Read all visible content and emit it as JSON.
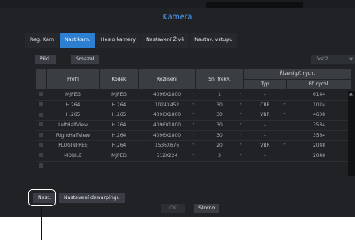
{
  "title": "Kamera",
  "tabs": [
    {
      "label": "Reg. Kam",
      "active": false
    },
    {
      "label": "Nast.kam.",
      "active": true
    },
    {
      "label": "Heslo kamery",
      "active": false
    },
    {
      "label": "Nastavení Živě",
      "active": false
    },
    {
      "label": "Nastav. vstupu",
      "active": false
    }
  ],
  "toolbar": {
    "add_label": "Přid.",
    "delete_label": "Smazat",
    "stream_select": "Vst2"
  },
  "table": {
    "headers": {
      "profile": "Profil",
      "codec": "Kodek",
      "resolution": "Rozlišení",
      "fps": "Sn. frekv.",
      "bitrate_group": "Řízení př. rych.",
      "type": "Typ",
      "bitrate": "Př. rychl."
    },
    "rows": [
      {
        "profile": "MJPEG",
        "codec": "MJPEG",
        "resolution": "4096X1800",
        "fps": "1",
        "type": "–",
        "bitrate": "6144"
      },
      {
        "profile": "H.264",
        "codec": "H.264",
        "resolution": "1024X452",
        "fps": "30",
        "type": "CBR",
        "bitrate": "1024"
      },
      {
        "profile": "H.265",
        "codec": "H.265",
        "resolution": "4096X1800",
        "fps": "30",
        "type": "VBR",
        "bitrate": "4608"
      },
      {
        "profile": "LeftHalfView",
        "codec": "H.264",
        "resolution": "4096X1800",
        "fps": "30",
        "type": "–",
        "bitrate": "3584"
      },
      {
        "profile": "RightHalfView",
        "codec": "H.264",
        "resolution": "4096X1800",
        "fps": "30",
        "type": "–",
        "bitrate": "3584"
      },
      {
        "profile": "PLUGINFREE",
        "codec": "H.264",
        "resolution": "1536X676",
        "fps": "20",
        "type": "VBR",
        "bitrate": "2048"
      },
      {
        "profile": "MOBILE",
        "codec": "MJPEG",
        "resolution": "512X224",
        "fps": "3",
        "type": "–",
        "bitrate": "2048"
      }
    ]
  },
  "bottom_buttons": {
    "settings_label": "Nast.",
    "dewarping_label": "Nastavení dewarpingu"
  },
  "footer": {
    "ok_label": "OK",
    "cancel_label": "Storno"
  }
}
